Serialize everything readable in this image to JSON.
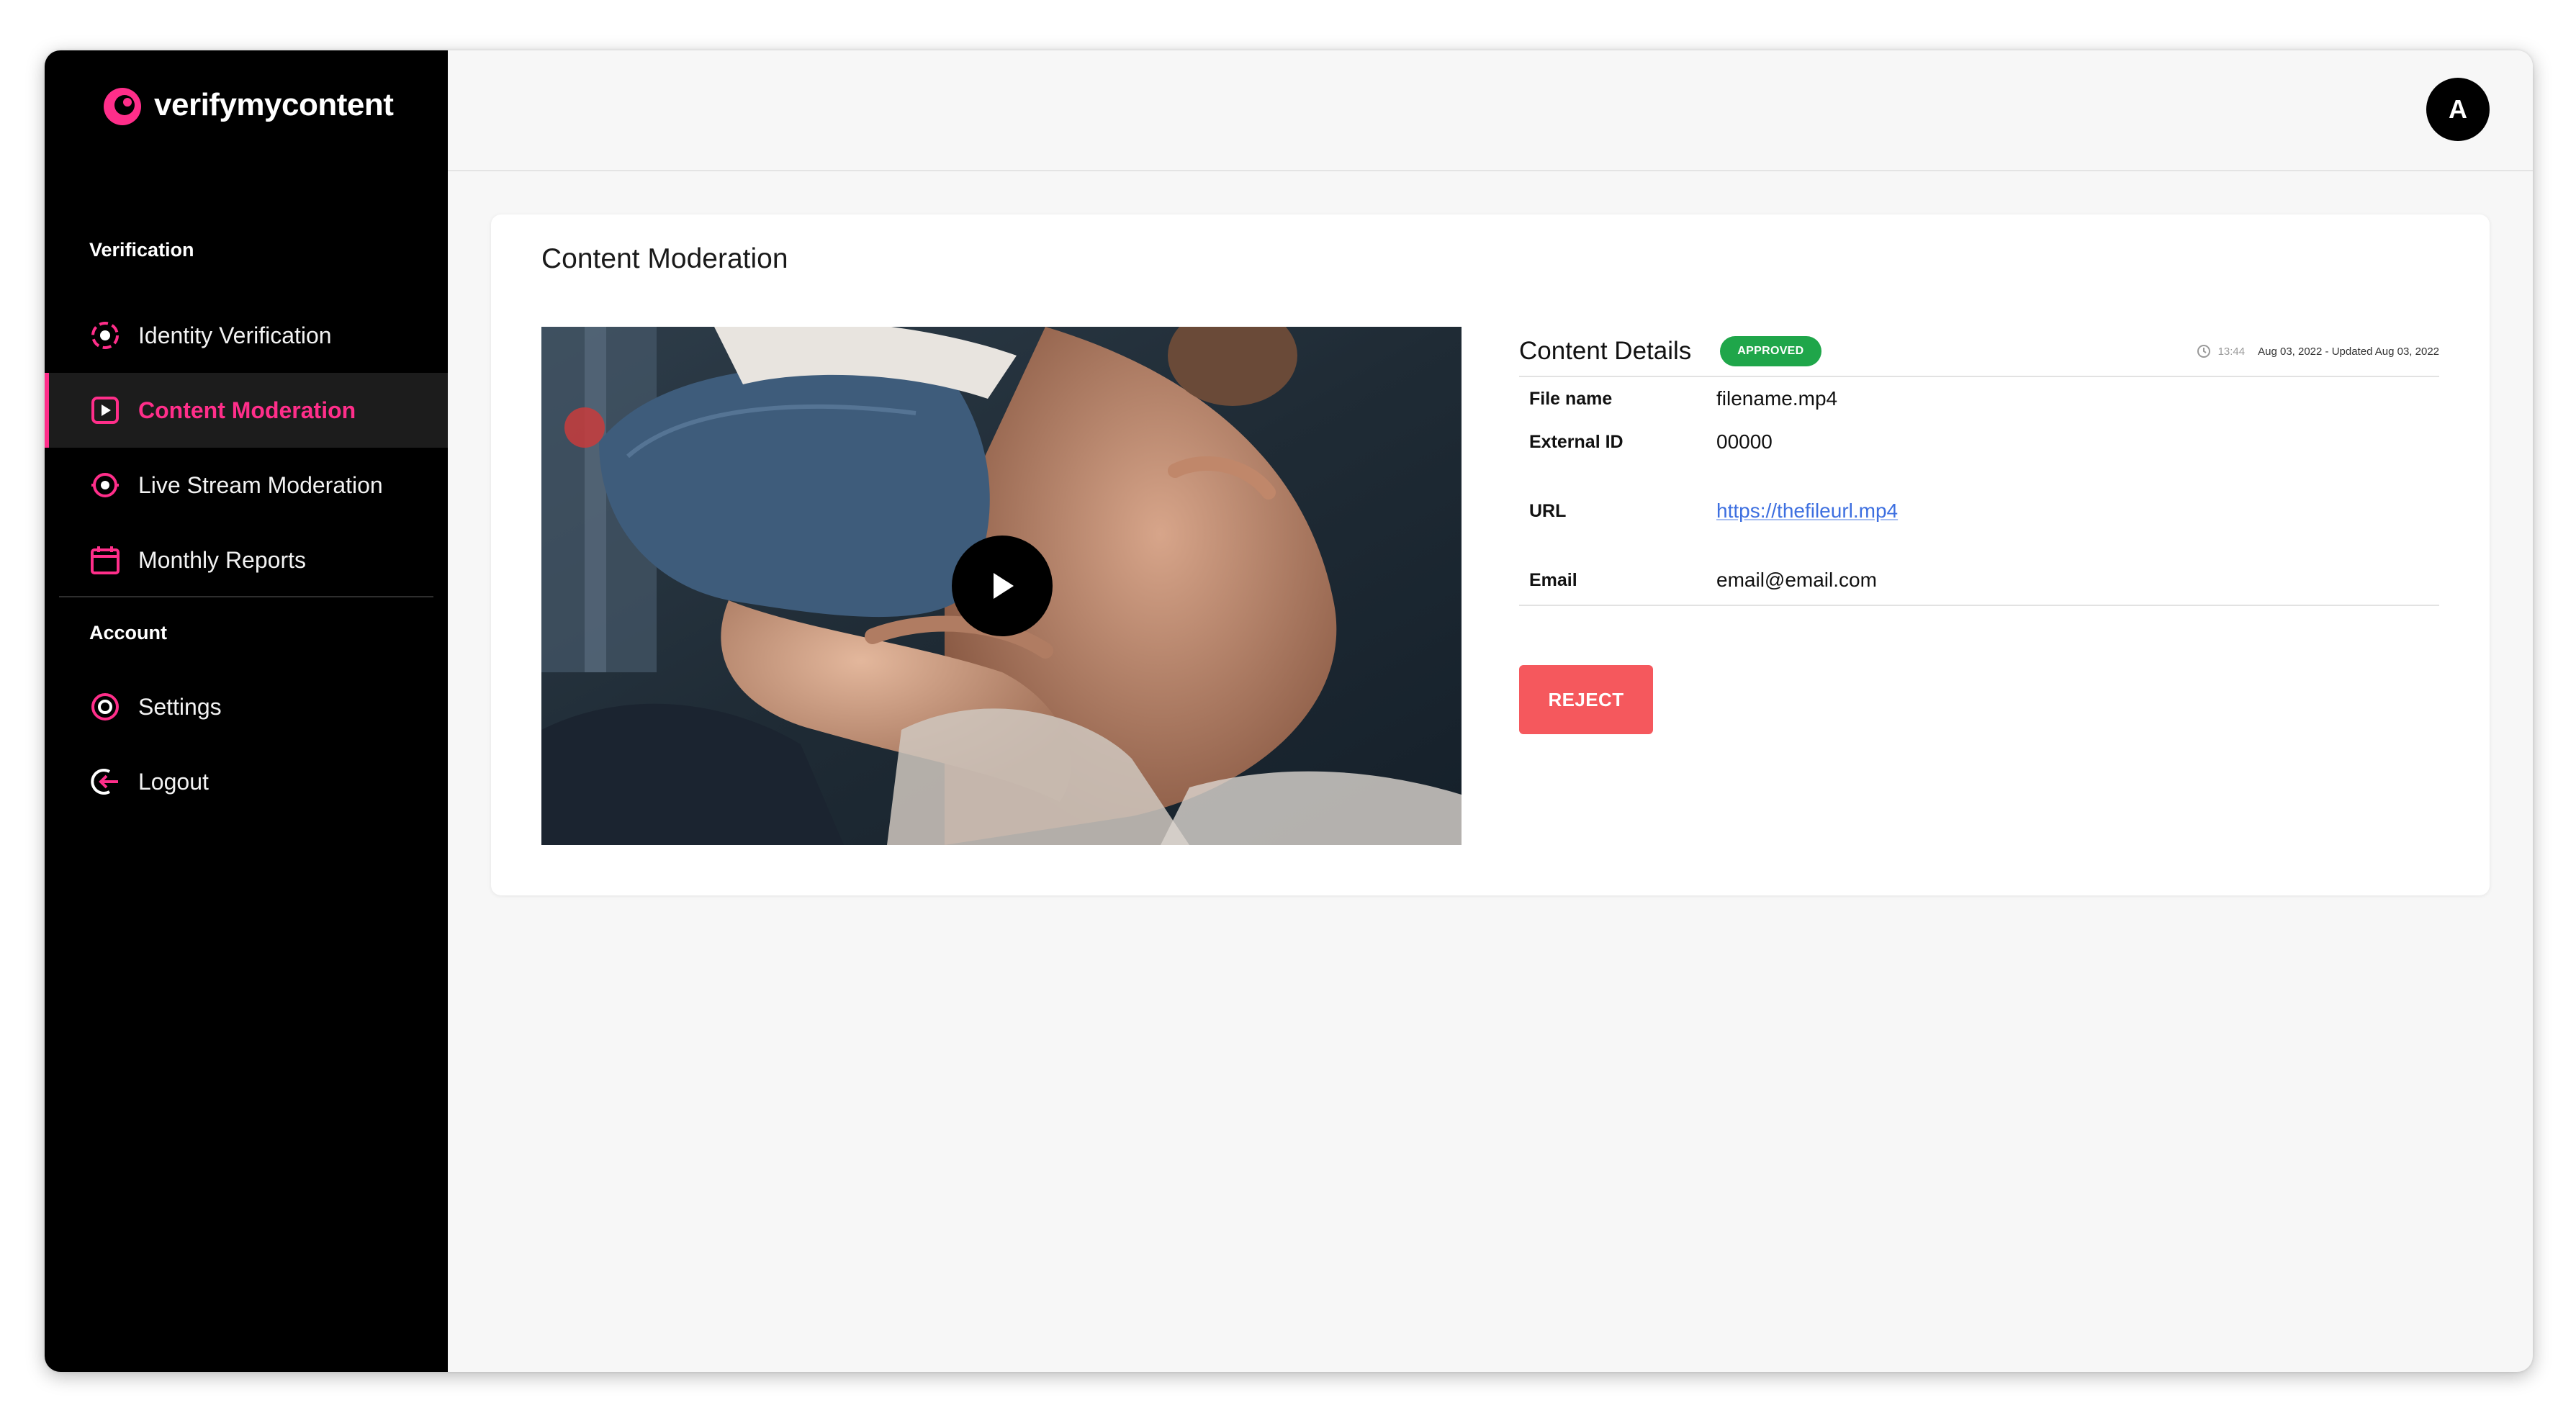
{
  "brand": {
    "name": "verifymycontent",
    "accent_color": "#ff2e8a"
  },
  "sidebar": {
    "sections": [
      {
        "label": "Verification",
        "items": [
          {
            "label": "Identity Verification",
            "icon": "identity-verification-icon",
            "active": false
          },
          {
            "label": "Content Moderation",
            "icon": "content-moderation-icon",
            "active": true
          },
          {
            "label": "Live Stream Moderation",
            "icon": "live-stream-icon",
            "active": false
          },
          {
            "label": "Monthly Reports",
            "icon": "calendar-icon",
            "active": false
          }
        ]
      },
      {
        "label": "Account",
        "items": [
          {
            "label": "Settings",
            "icon": "settings-icon",
            "active": false
          },
          {
            "label": "Logout",
            "icon": "logout-icon",
            "active": false
          }
        ]
      }
    ]
  },
  "topbar": {
    "avatar_initial": "A"
  },
  "main": {
    "title": "Content Moderation",
    "video": {
      "icon": "play-icon"
    },
    "details": {
      "title": "Content Details",
      "status": "APPROVED",
      "status_color": "#1fa64a",
      "time": "13:44",
      "dates": "Aug 03, 2022 - Updated Aug 03, 2022",
      "fields": [
        {
          "label": "File name",
          "value": "filename.mp4"
        },
        {
          "label": "External ID",
          "value": "00000"
        },
        {
          "label": "URL",
          "value": "https://thefileurl.mp4"
        },
        {
          "label": "Email",
          "value": "email@email.com"
        }
      ],
      "reject_label": "REJECT",
      "reject_color": "#f5585d"
    }
  }
}
